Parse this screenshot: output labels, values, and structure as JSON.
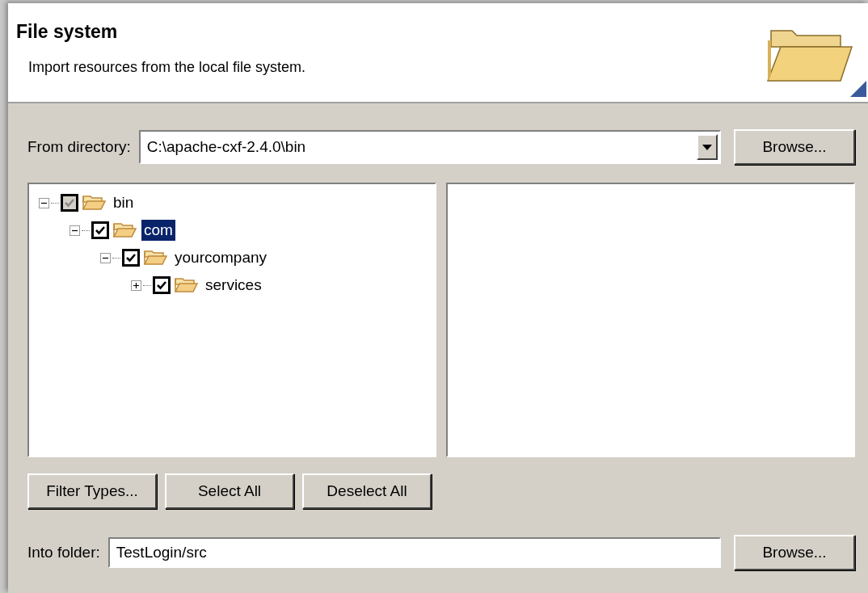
{
  "header": {
    "title": "File system",
    "description": "Import resources from the local file system."
  },
  "from_directory": {
    "label": "From directory:",
    "value": "C:\\apache-cxf-2.4.0\\bin",
    "browse": "Browse..."
  },
  "tree": [
    {
      "label": "bin",
      "expanded": true,
      "checked": true,
      "grayed": true,
      "selected": false,
      "children": [
        {
          "label": "com",
          "expanded": true,
          "checked": true,
          "grayed": false,
          "selected": true,
          "children": [
            {
              "label": "yourcompany",
              "expanded": true,
              "checked": true,
              "grayed": false,
              "selected": false,
              "children": [
                {
                  "label": "services",
                  "expanded": false,
                  "checked": true,
                  "grayed": false,
                  "selected": false
                }
              ]
            }
          ]
        }
      ]
    }
  ],
  "buttons": [
    "Filter Types...",
    "Select All",
    "Deselect All"
  ],
  "into_folder": {
    "label": "Into folder:",
    "value": "TestLogin/src",
    "browse": "Browse..."
  }
}
